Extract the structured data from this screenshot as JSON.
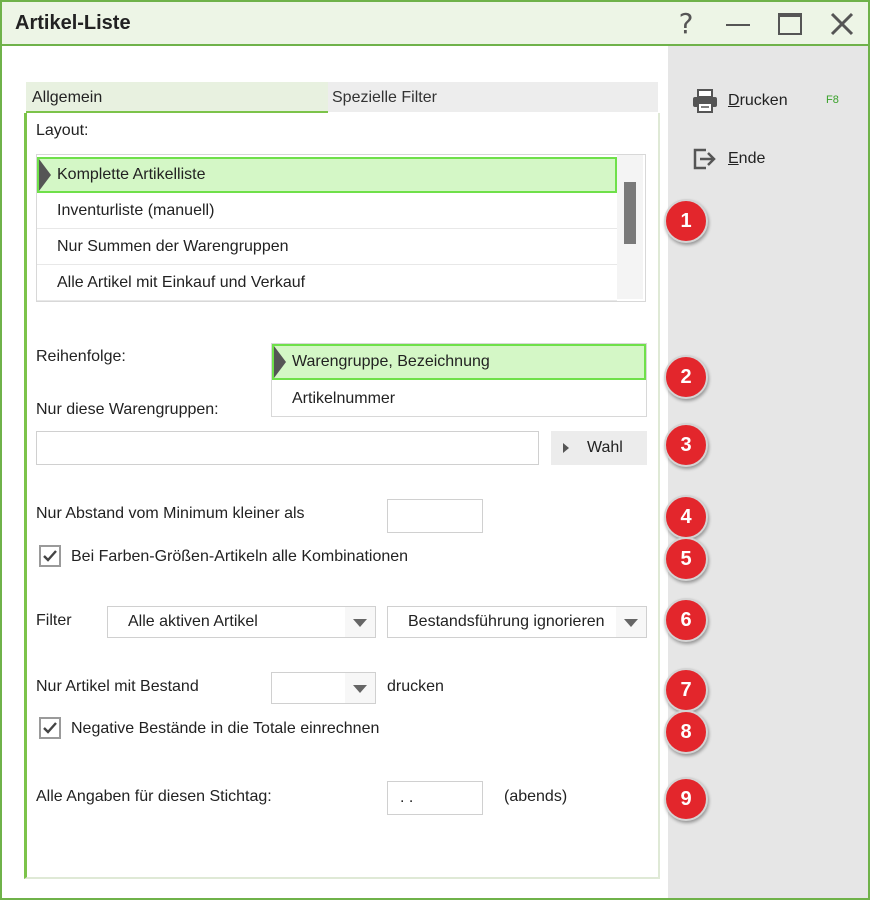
{
  "window": {
    "title": "Artikel-Liste",
    "help_glyph": "?"
  },
  "actions": {
    "drucken_first": "D",
    "drucken_rest": "rucken",
    "drucken_key": "F8",
    "ende_first": "E",
    "ende_rest": "nde"
  },
  "tabs": [
    {
      "label": "Allgemein"
    },
    {
      "label": "Spezielle Filter"
    }
  ],
  "layout": {
    "label": "Layout:",
    "items": [
      {
        "label": "Komplette Artikelliste"
      },
      {
        "label": "Inventurliste (manuell)"
      },
      {
        "label": "Nur Summen der Warengruppen"
      },
      {
        "label": "Alle Artikel mit Einkauf und Verkauf"
      }
    ]
  },
  "reihenfolge": {
    "label": "Reihenfolge:",
    "items": [
      {
        "label": "Warengruppe, Bezeichnung"
      },
      {
        "label": "Artikelnummer"
      }
    ]
  },
  "warengruppen": {
    "label": "Nur diese Warengruppen:",
    "value": "",
    "button": "Wahl"
  },
  "abstand": {
    "label": "Nur Abstand vom Minimum kleiner als",
    "value": ""
  },
  "farben": {
    "label": "Bei Farben-Größen-Artikeln alle Kombinationen",
    "checked": true
  },
  "filter": {
    "label": "Filter",
    "select1": "Alle aktiven Artikel",
    "select2": "Bestandsführung ignorieren"
  },
  "bestand": {
    "label": "Nur Artikel mit Bestand",
    "value": "",
    "suffix": "drucken"
  },
  "negative": {
    "label": "Negative Bestände in die Totale einrechnen",
    "checked": true
  },
  "stichtag": {
    "label": "Alle Angaben für diesen Stichtag:",
    "value": ". .",
    "suffix": "(abends)"
  },
  "badges": [
    "1",
    "2",
    "3",
    "4",
    "5",
    "6",
    "7",
    "8",
    "9"
  ],
  "colors": {
    "accent": "#6fb24a",
    "selection": "#d4f7c6",
    "badge": "#e3262c"
  }
}
